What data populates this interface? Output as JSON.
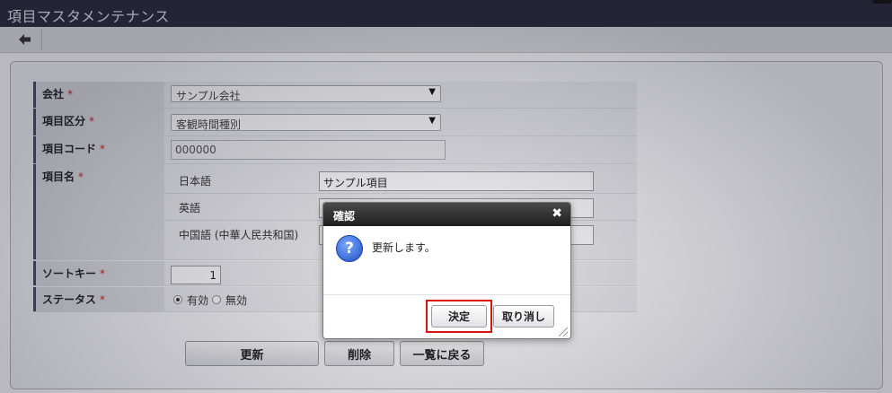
{
  "app": {
    "title": "項目マスタメンテナンス"
  },
  "toolbar": {
    "back_icon": "arrow-left-icon"
  },
  "form": {
    "company": {
      "label": "会社",
      "required": "*",
      "value": "サンプル会社"
    },
    "item_category": {
      "label": "項目区分",
      "required": "*",
      "value": "客観時間種別"
    },
    "item_code": {
      "label": "項目コード",
      "required": "*",
      "value": "000000"
    },
    "item_name": {
      "label": "項目名",
      "required": "*",
      "langs": [
        {
          "label": "日本語",
          "value": "サンプル項目"
        },
        {
          "label": "英語",
          "value": ""
        },
        {
          "label": "中国語 (中華人民共和国)",
          "value": ""
        }
      ]
    },
    "sort_key": {
      "label": "ソートキー",
      "required": "*",
      "value": "1"
    },
    "status": {
      "label": "ステータス",
      "required": "*",
      "options": [
        "有効",
        "無効"
      ],
      "selected": "有効"
    }
  },
  "buttons": {
    "update": "更新",
    "delete": "削除",
    "back_to_list": "一覧に戻る"
  },
  "dialog": {
    "title": "確認",
    "close_icon": "close-icon",
    "icon": "question-icon",
    "icon_glyph": "?",
    "message": "更新します。",
    "ok": "決定",
    "cancel": "取り消し",
    "highlight_color": "#e01010"
  }
}
